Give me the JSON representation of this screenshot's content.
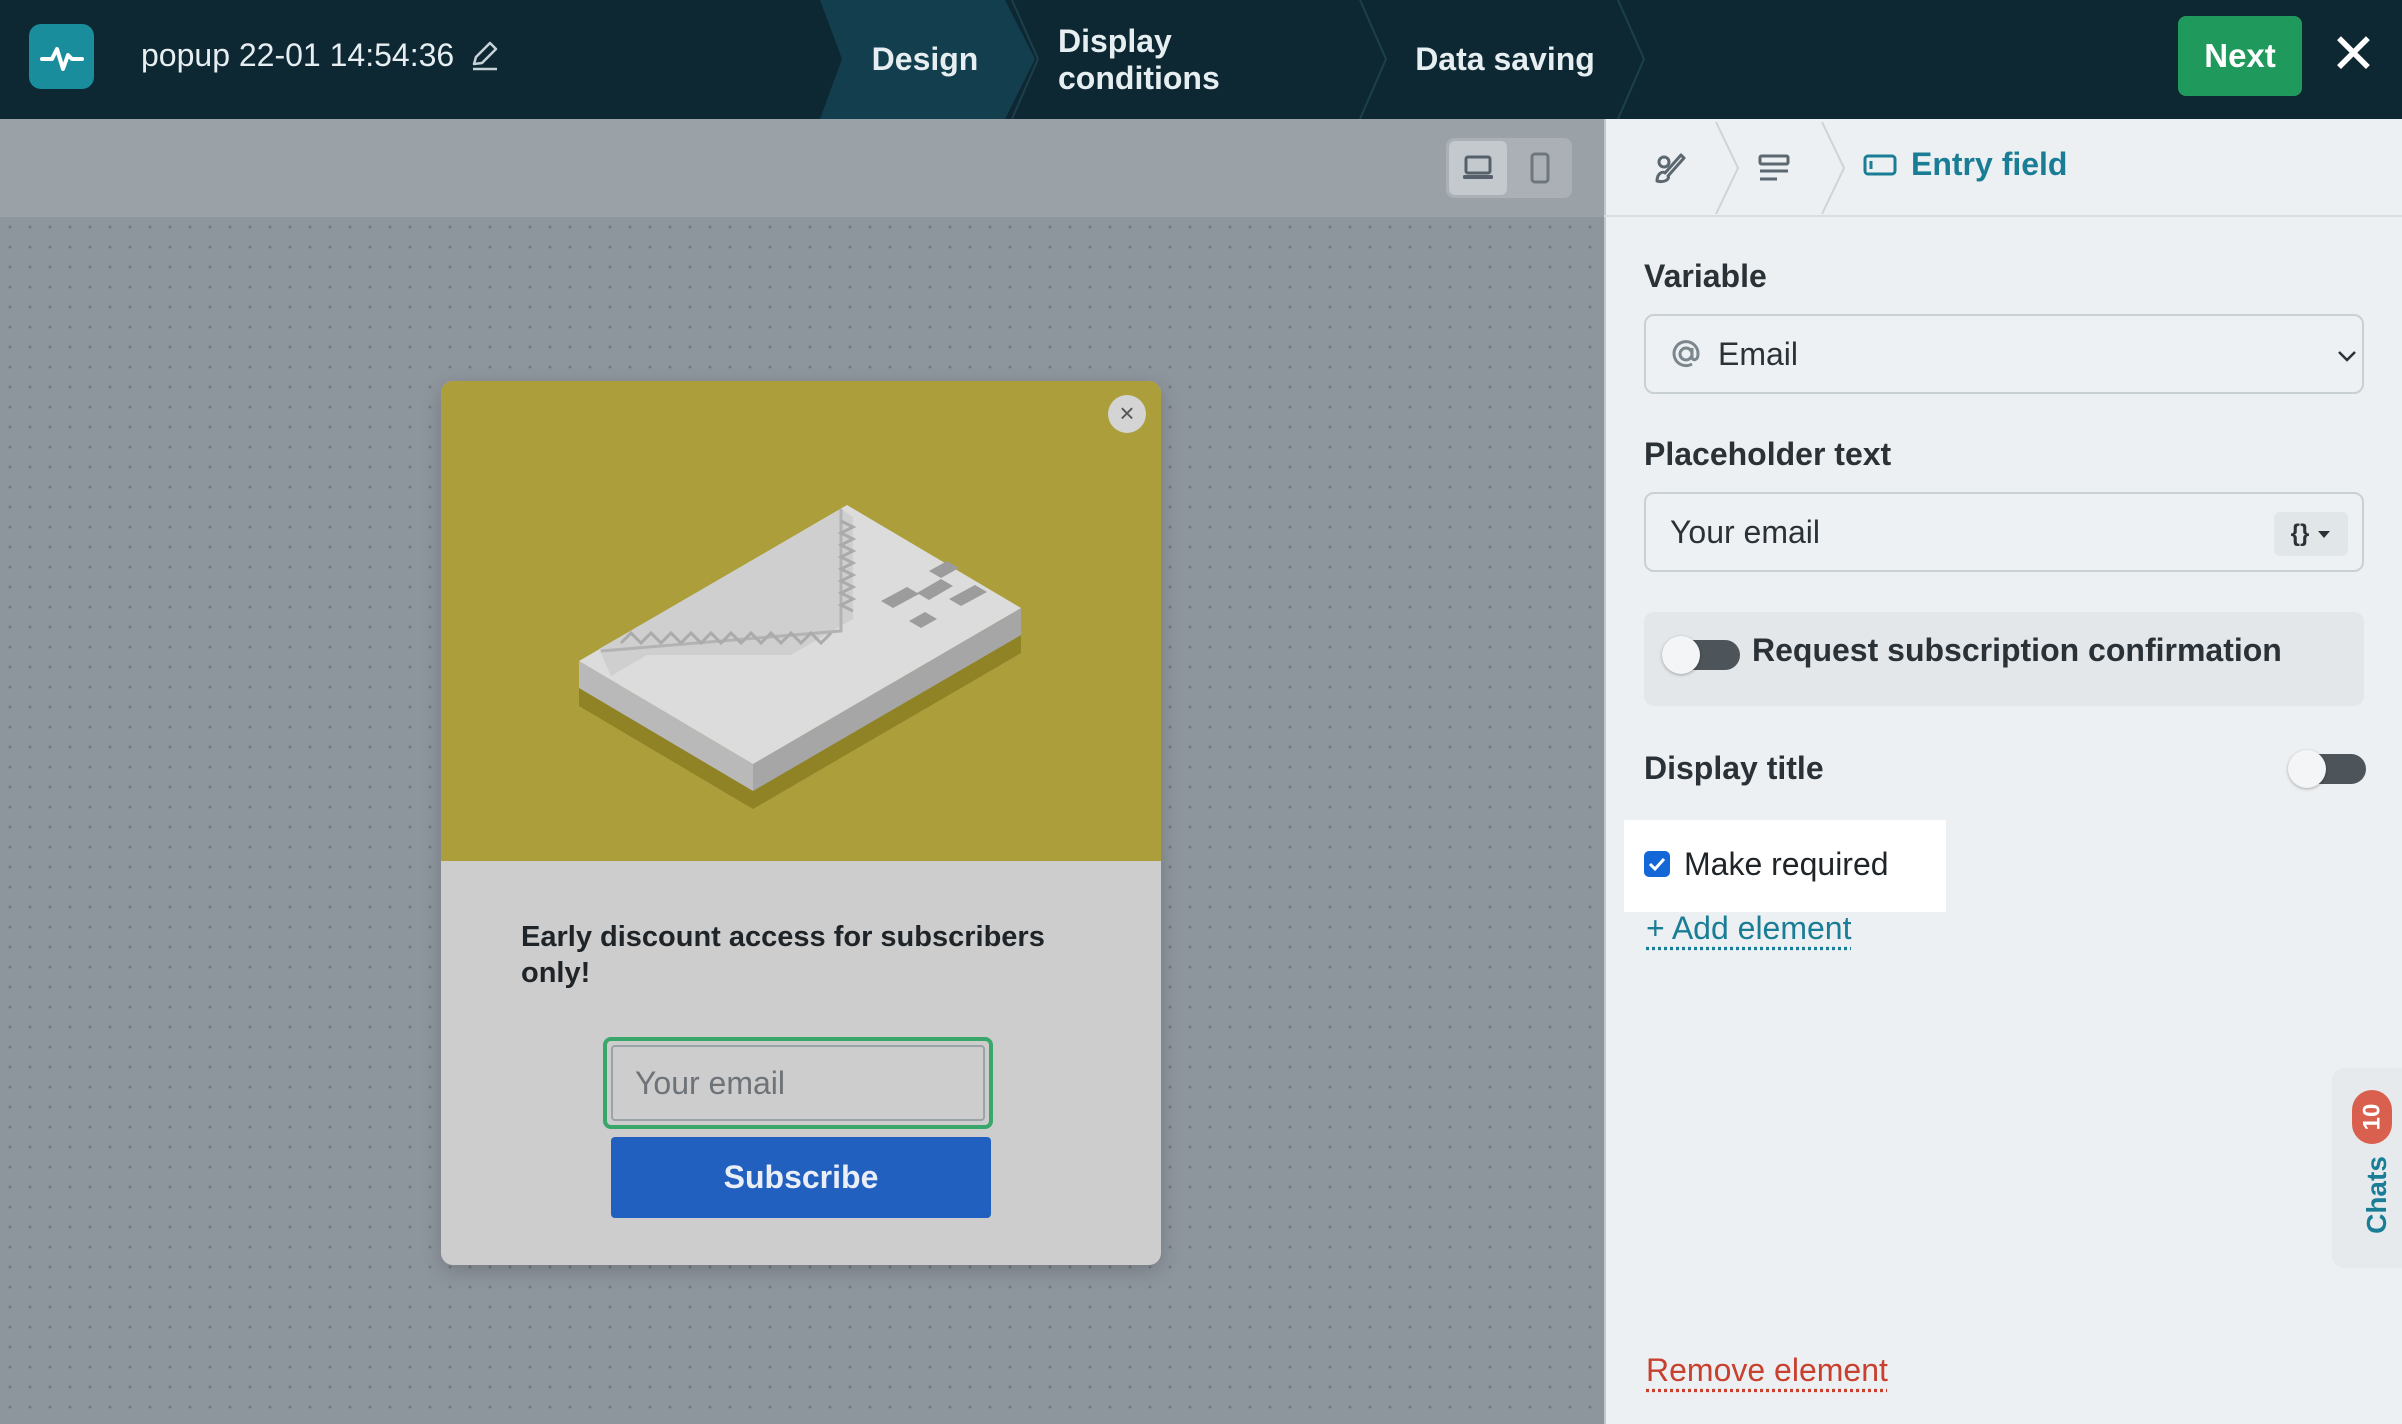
{
  "header": {
    "title": "popup 22-01 14:54:36",
    "steps": [
      {
        "label": "Design",
        "active": true
      },
      {
        "label": "Display conditions",
        "active": false
      },
      {
        "label": "Data saving",
        "active": false
      }
    ],
    "next_label": "Next",
    "close_glyph": "✕"
  },
  "canvas": {
    "device_options": [
      "desktop-icon",
      "mobile-icon"
    ],
    "selected_device": "desktop"
  },
  "popup": {
    "close_glyph": "×",
    "text": "Early discount access for subscribers only!",
    "input_placeholder": "Your email",
    "button_label": "Subscribe",
    "colors": {
      "image_bg": "#ab9e3b",
      "button": "#2260c0",
      "input_border": "#39a66a"
    }
  },
  "panel": {
    "breadcrumb": {
      "icons": [
        "brush-icon",
        "form-fields-icon"
      ],
      "active_label": "Entry field"
    },
    "variable_label": "Variable",
    "variable_value": "Email",
    "placeholder_label": "Placeholder text",
    "placeholder_value": "Your email",
    "variable_insert_label": "{}",
    "subscription_confirmation_label": "Request subscription confirmation",
    "subscription_confirmation_on": false,
    "display_title_label": "Display title",
    "display_title_on": false,
    "make_required_label": "Make required",
    "make_required_checked": true,
    "add_element_label": "+ Add element",
    "remove_element_label": "Remove element"
  },
  "chats": {
    "label": "Chats",
    "count": "10"
  },
  "colors": {
    "topbar": "#0d2833",
    "accent_teal": "#1a7d96",
    "next_green": "#1f9a5c",
    "danger_red": "#c8412f"
  }
}
